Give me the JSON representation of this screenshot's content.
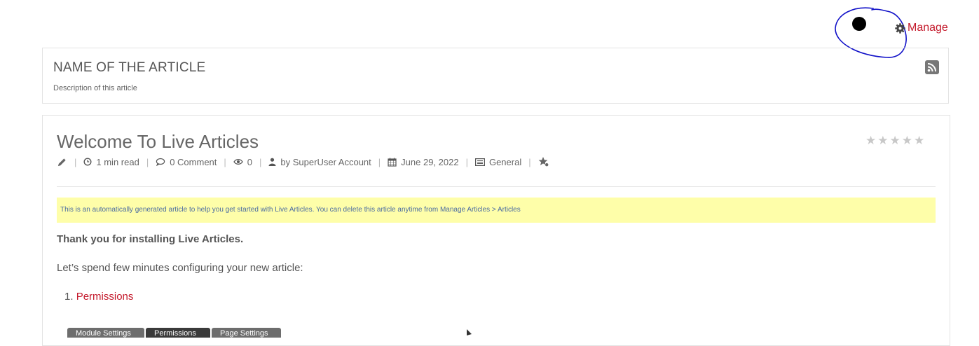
{
  "manage": {
    "label": "Manage"
  },
  "header": {
    "title": "NAME OF THE ARTICLE",
    "description": "Description of this article"
  },
  "article": {
    "title": "Welcome To Live Articles",
    "rating": {
      "value": 0,
      "max": 5
    },
    "meta": {
      "read_time": "1 min read",
      "comments": "0 Comment",
      "views": "0",
      "author": "by SuperUser Account",
      "date": "June 29, 2022",
      "category": "General"
    },
    "notice": "This is an automatically generated article to help you get started with Live Articles. You can delete this article anytime from Manage Articles > Articles",
    "thank_you": "Thank you for installing Live Articles.",
    "intro": "Let’s spend few minutes configuring your new article:",
    "list": [
      {
        "number": "1.",
        "label": "Permissions"
      }
    ],
    "tabs": [
      {
        "label": "Module Settings"
      },
      {
        "label": "Permissions"
      },
      {
        "label": "Page Settings"
      }
    ]
  },
  "colors": {
    "accent": "#c4192b",
    "notice_bg": "#fefea9",
    "notice_text": "#4a6ba1",
    "annotation": "#1010c8"
  }
}
